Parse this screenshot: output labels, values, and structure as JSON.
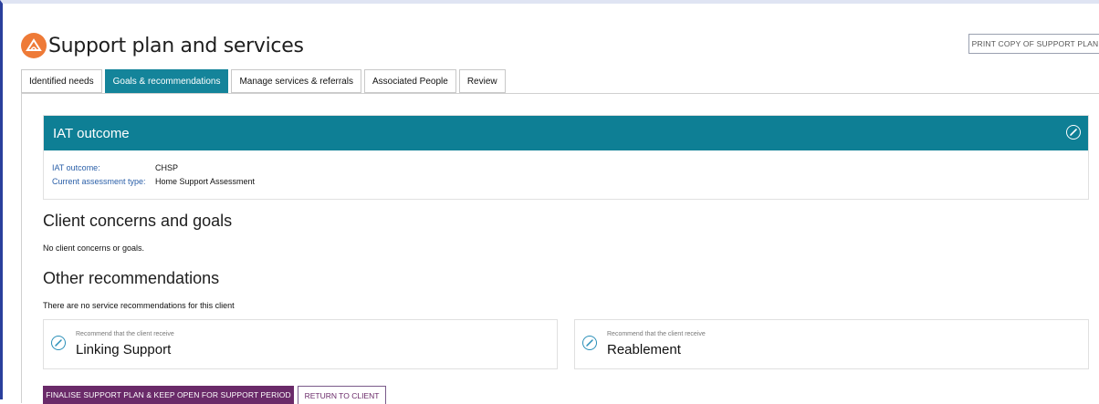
{
  "header": {
    "title": "Support plan and services",
    "print_label": "PRINT COPY OF SUPPORT PLAN"
  },
  "colors": {
    "accent": "#0e7f95",
    "logo": "#ee7a37",
    "primary_button": "#6a2a69"
  },
  "tabs": [
    {
      "label": "Identified needs",
      "active": false
    },
    {
      "label": "Goals & recommendations",
      "active": true
    },
    {
      "label": "Manage services & referrals",
      "active": false
    },
    {
      "label": "Associated People",
      "active": false
    },
    {
      "label": "Review",
      "active": false
    }
  ],
  "iat": {
    "heading": "IAT outcome",
    "rows": [
      {
        "label": "IAT outcome:",
        "value": "CHSP"
      },
      {
        "label": "Current assessment type:",
        "value": "Home Support Assessment"
      }
    ]
  },
  "client_concerns": {
    "heading": "Client concerns and goals",
    "message": "No client concerns or goals."
  },
  "other_recommendations": {
    "heading": "Other recommendations",
    "message": "There are no service recommendations for this client",
    "cards": [
      {
        "sub": "Recommend that the client receive",
        "main": "Linking Support"
      },
      {
        "sub": "Recommend that the client receive",
        "main": "Reablement"
      }
    ]
  },
  "actions": {
    "finalise_label": "FINALISE SUPPORT PLAN & KEEP OPEN FOR SUPPORT PERIOD",
    "return_label": "RETURN TO CLIENT"
  }
}
